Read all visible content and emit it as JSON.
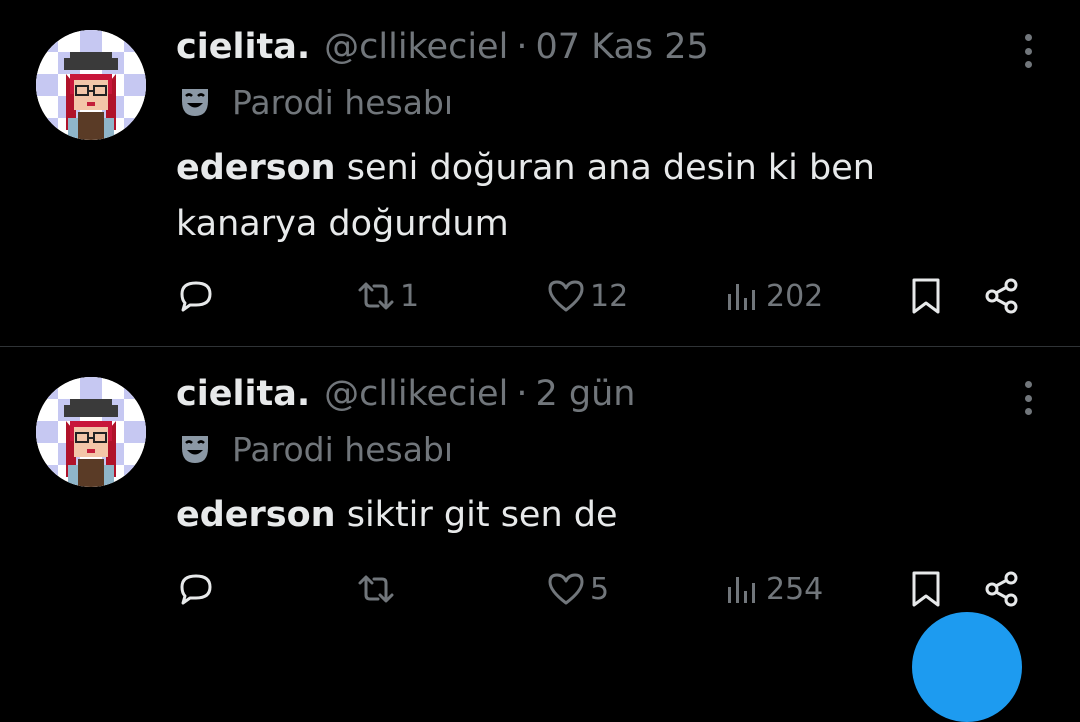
{
  "colors": {
    "background": "#000000",
    "primary_text": "#e7e9ea",
    "secondary_text": "#71767b",
    "divider": "#2f3336",
    "accent": "#1d9bf0"
  },
  "tweets": [
    {
      "display_name": "cielita.",
      "handle": "@cllikeciel",
      "separator": "·",
      "time": "07 Kas 25",
      "badge_icon": "theater-mask-icon",
      "badge_label": "Parodi hesabı",
      "mention": "ederson",
      "text": " seni doğuran ana desin ki ben kanarya doğurdum",
      "reply_count": "",
      "retweet_count": "1",
      "like_count": "12",
      "view_count": "202"
    },
    {
      "display_name": "cielita.",
      "handle": "@cllikeciel",
      "separator": "·",
      "time": "2 gün",
      "badge_icon": "theater-mask-icon",
      "badge_label": "Parodi hesabı",
      "mention": "ederson",
      "text": " siktir git sen de",
      "reply_count": "",
      "retweet_count": "",
      "like_count": "5",
      "view_count": "254"
    }
  ]
}
